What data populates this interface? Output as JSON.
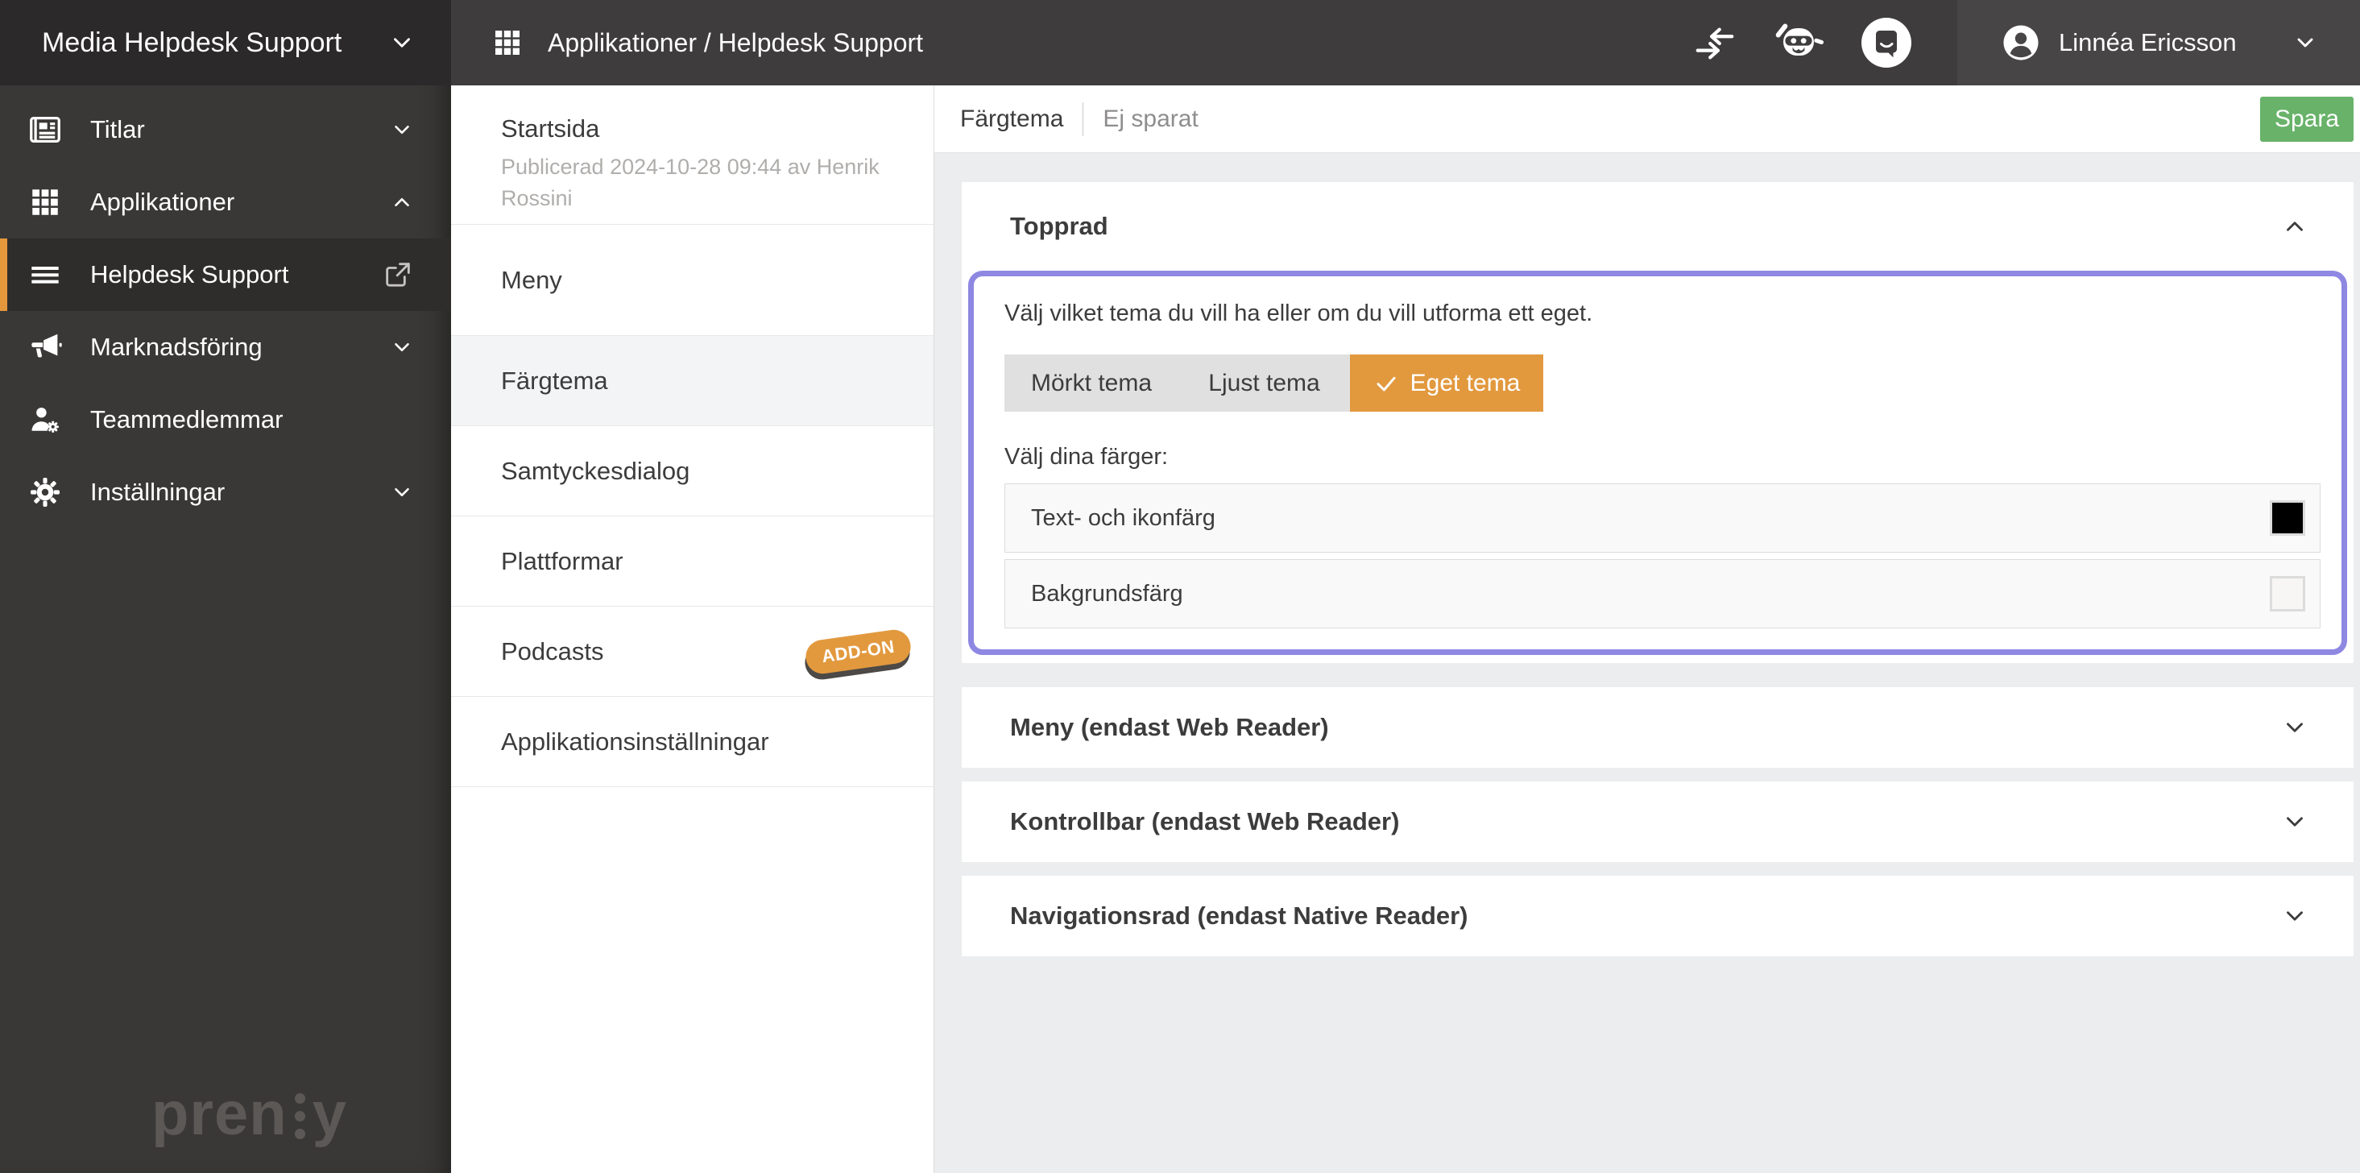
{
  "brand": {
    "workspace": "Media Helpdesk Support",
    "logo_pre": "pren",
    "logo_post": "y"
  },
  "sidebar": {
    "items": [
      {
        "label": "Titlar",
        "icon": "newspaper-icon",
        "expandable": true
      },
      {
        "label": "Applikationer",
        "icon": "grid-icon",
        "expanded": true
      },
      {
        "label": "Helpdesk Support",
        "icon": "menu-lines-icon",
        "active": true,
        "trailing_icon": "external-link-icon"
      },
      {
        "label": "Marknadsföring",
        "icon": "megaphone-icon",
        "expandable": true
      },
      {
        "label": "Teammedlemmar",
        "icon": "user-gear-icon"
      },
      {
        "label": "Inställningar",
        "icon": "gear-icon",
        "expandable": true
      }
    ]
  },
  "topbar": {
    "breadcrumb": "Applikationer / Helpdesk Support",
    "icons": [
      "collapse-arrows-icon",
      "bot-icon",
      "support-chat-icon"
    ],
    "user": {
      "name": "Linnéa Ericsson",
      "icon": "user-circle-icon"
    }
  },
  "subnav": {
    "items": [
      {
        "label": "Startsida",
        "meta": "Publicerad 2024-10-28 09:44 av Henrik Rossini"
      },
      {
        "label": "Meny"
      },
      {
        "label": "Färgtema",
        "active": true
      },
      {
        "label": "Samtyckesdialog"
      },
      {
        "label": "Plattformar"
      },
      {
        "label": "Podcasts",
        "badge": "ADD-ON"
      },
      {
        "label": "Applikationsinställningar"
      }
    ]
  },
  "main": {
    "title": "Färgtema",
    "status": "Ej sparat",
    "save_label": "Spara",
    "topprad": {
      "title": "Topprad",
      "description": "Välj vilket tema du vill ha eller om du vill utforma ett eget.",
      "themes": [
        {
          "label": "Mörkt tema",
          "selected": false
        },
        {
          "label": "Ljust tema",
          "selected": false
        },
        {
          "label": "Eget tema",
          "selected": true
        }
      ],
      "colors_label": "Välj dina färger:",
      "color_rows": [
        {
          "label": "Text- och ikonfärg",
          "value": "#000000"
        },
        {
          "label": "Bakgrundsfärg",
          "value": "#f7f6f5"
        }
      ]
    },
    "accordions": [
      {
        "title": "Meny (endast Web Reader)",
        "collapsed": true
      },
      {
        "title": "Kontrollbar (endast Web Reader)",
        "collapsed": true
      },
      {
        "title": "Navigationsrad (endast Native Reader)",
        "collapsed": true
      }
    ]
  },
  "colors": {
    "accent_orange": "#e2993e",
    "save_green": "#68b269",
    "highlight_purple": "#8e88e2",
    "sidebar_dark": "#3a3837",
    "topbar_dark": "#3e3c3c"
  }
}
